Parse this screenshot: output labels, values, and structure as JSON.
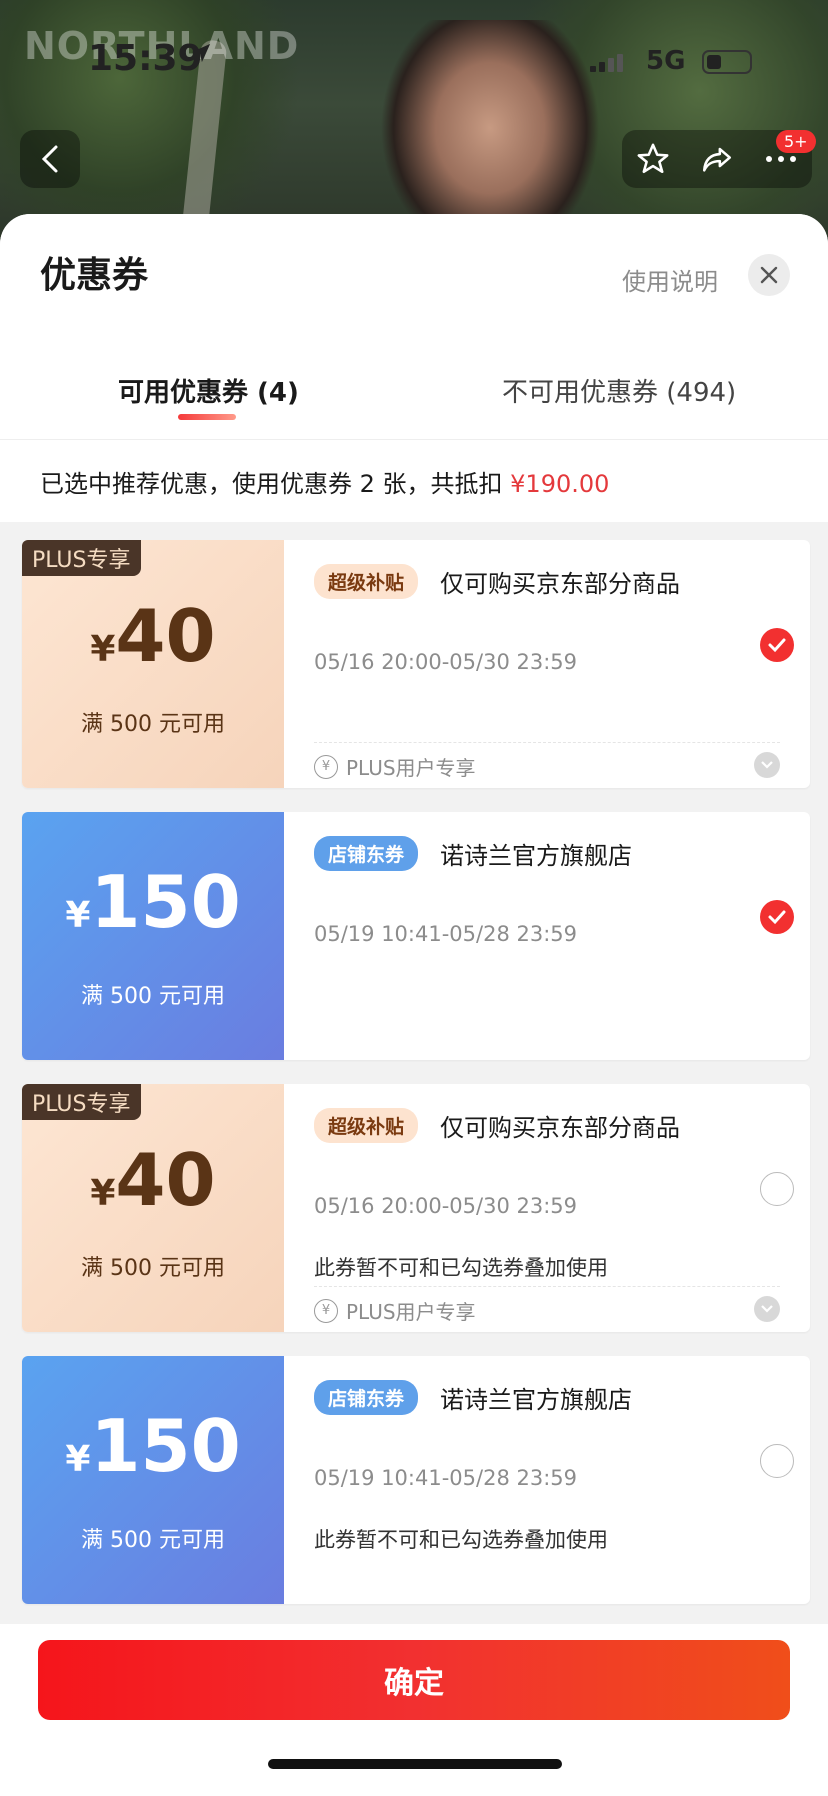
{
  "status_bar": {
    "time": "15:39",
    "network": "5G"
  },
  "background": {
    "brand_text": "NORTHLAND"
  },
  "nav": {
    "badge": "5+"
  },
  "sheet": {
    "title": "优惠券",
    "help_link": "使用说明",
    "tabs": [
      {
        "label": "可用优惠券 (4)",
        "active": true
      },
      {
        "label": "不可用优惠券 (494)",
        "active": false
      }
    ],
    "summary": {
      "text": "已选中推荐优惠，使用优惠券 2 张，共抵扣 ",
      "amount": "¥190.00"
    }
  },
  "coupons": [
    {
      "type": "plus",
      "plus_tag": "PLUS专享",
      "currency": "¥",
      "amount": "40",
      "condition": "满 500 元可用",
      "tag": "超级补贴",
      "title": "仅可购买京东部分商品",
      "validity": "05/16 20:00-05/30 23:59",
      "note": "",
      "footer": "PLUS用户专享",
      "selected": true
    },
    {
      "type": "shop",
      "currency": "¥",
      "amount": "150",
      "condition": "满 500 元可用",
      "tag": "店铺东券",
      "title": "诺诗兰官方旗舰店",
      "validity": "05/19 10:41-05/28 23:59",
      "note": "",
      "selected": true
    },
    {
      "type": "plus",
      "plus_tag": "PLUS专享",
      "currency": "¥",
      "amount": "40",
      "condition": "满 500 元可用",
      "tag": "超级补贴",
      "title": "仅可购买京东部分商品",
      "validity": "05/16 20:00-05/30 23:59",
      "note": "此券暂不可和已勾选券叠加使用",
      "footer": "PLUS用户专享",
      "selected": false
    },
    {
      "type": "shop",
      "currency": "¥",
      "amount": "150",
      "condition": "满 500 元可用",
      "tag": "店铺东券",
      "title": "诺诗兰官方旗舰店",
      "validity": "05/19 10:41-05/28 23:59",
      "note": "此券暂不可和已勾选券叠加使用",
      "selected": false
    }
  ],
  "footer": {
    "confirm_label": "确定"
  },
  "colors": {
    "accent": "#f23030",
    "plus_text": "#5a3416",
    "shop_gradient_start": "#5aa3f0"
  }
}
